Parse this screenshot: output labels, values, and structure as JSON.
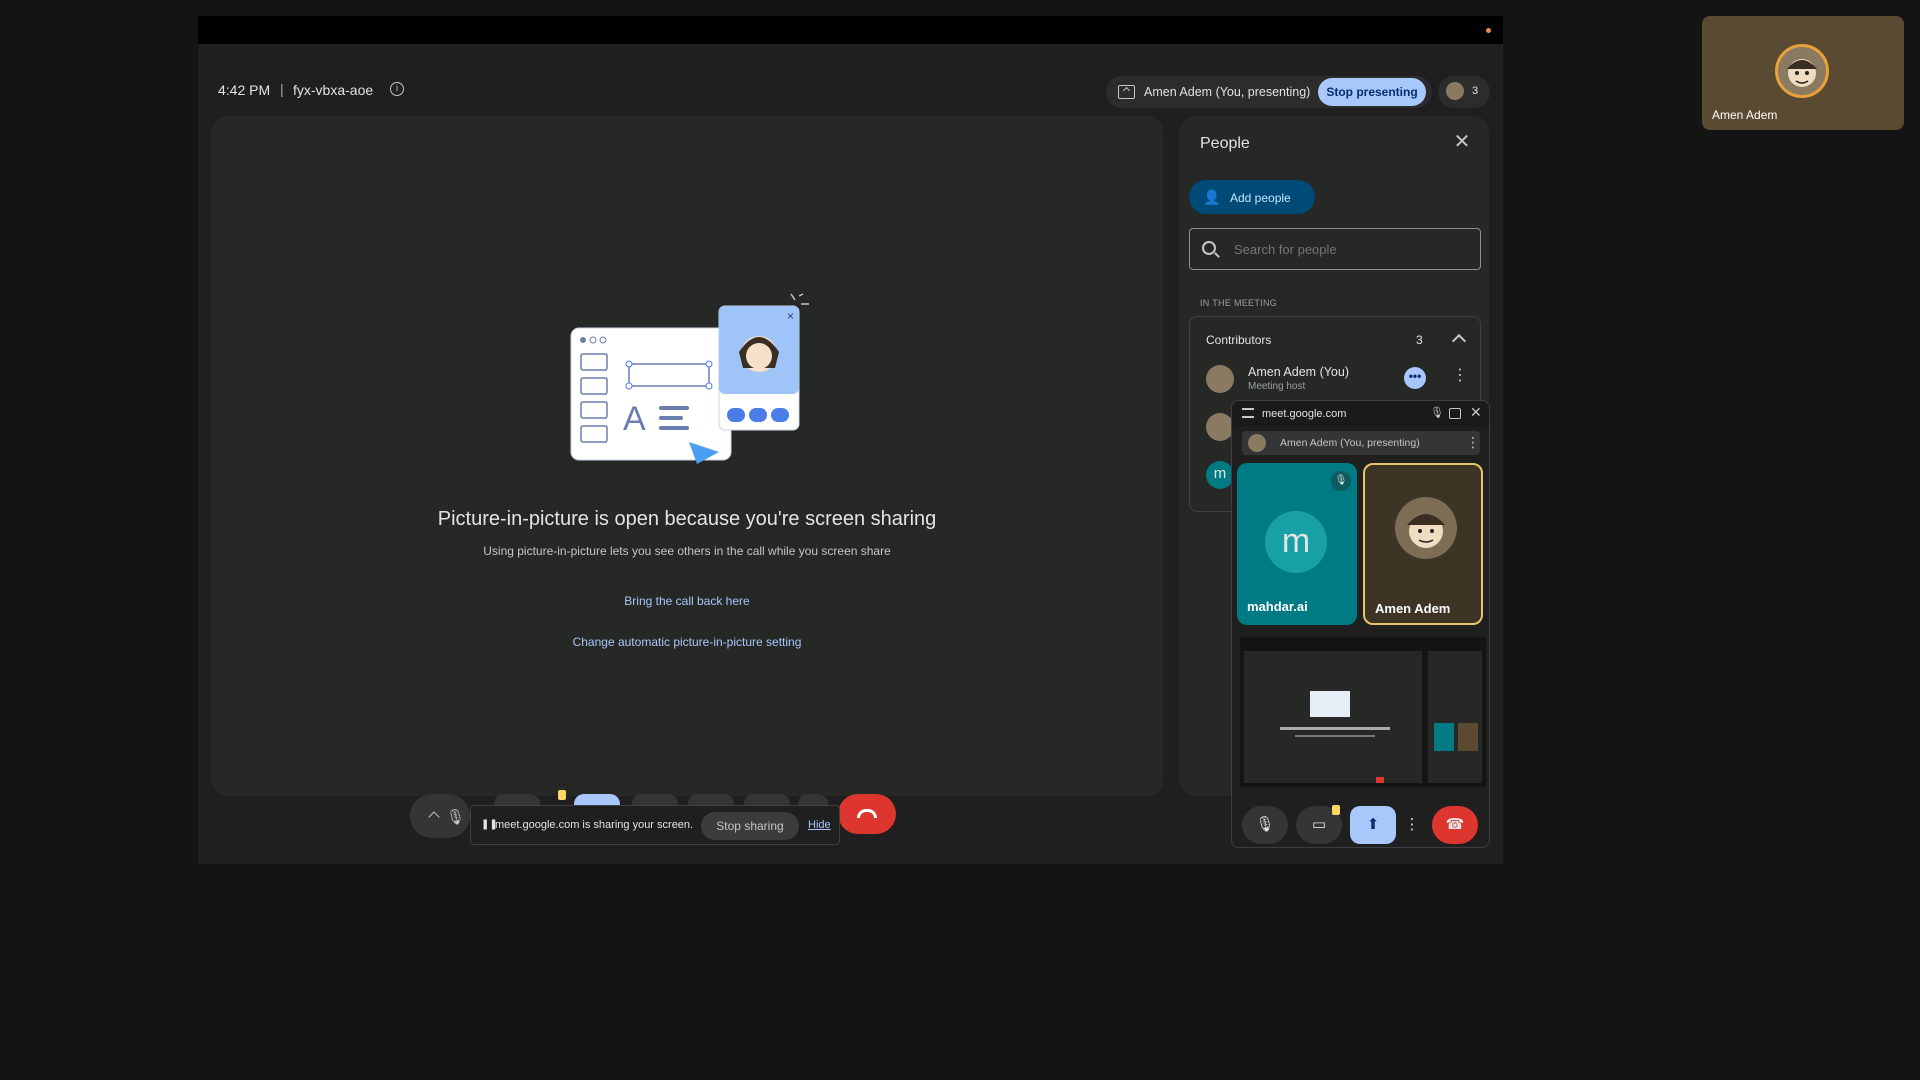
{
  "header": {
    "time": "4:42 PM",
    "separator": "|",
    "meeting_code": "fyx-vbxa-aoe",
    "presenting_label": "Amen Adem (You, presenting)",
    "stop_presenting": "Stop presenting",
    "participant_count": "3"
  },
  "stage": {
    "title": "Picture-in-picture is open because you're screen sharing",
    "subtitle": "Using picture-in-picture lets you see others in the call while you screen share",
    "bring_back": "Bring the call back here",
    "change_setting": "Change automatic picture-in-picture setting"
  },
  "people_panel": {
    "title": "People",
    "add_people": "Add people",
    "search_placeholder": "Search for people",
    "section_label": "IN THE MEETING",
    "contributors_label": "Contributors",
    "contributors_count": "3",
    "people": [
      {
        "name": "Amen Adem (You)",
        "role": "Meeting host"
      },
      {
        "name": "",
        "role": ""
      },
      {
        "initial": "m",
        "name": ""
      }
    ]
  },
  "sharing_bar": {
    "message": "meet.google.com is sharing your screen.",
    "stop_sharing": "Stop sharing",
    "hide": "Hide"
  },
  "pip": {
    "url": "meet.google.com",
    "presenter_label": "Amen Adem (You, presenting)",
    "tiles": [
      {
        "initial": "m",
        "name": "mahdar.ai"
      },
      {
        "name": "Amen Adem"
      }
    ]
  },
  "self_view": {
    "name": "Amen Adem"
  },
  "colors": {
    "accent": "#a8c7fa",
    "end_call": "#dc362e",
    "teal_avatar": "#007b83",
    "speaker_highlight": "#e9c46a",
    "warning": "#fdd663"
  },
  "icons": [
    "info-icon",
    "present-icon",
    "close-icon",
    "add-person-icon",
    "search-icon",
    "chevron-up-icon",
    "more-vert-icon",
    "mic-icon",
    "mic-off-icon",
    "camera-icon",
    "present-screen-icon",
    "hangup-icon",
    "pause-icon",
    "expand-icon"
  ]
}
